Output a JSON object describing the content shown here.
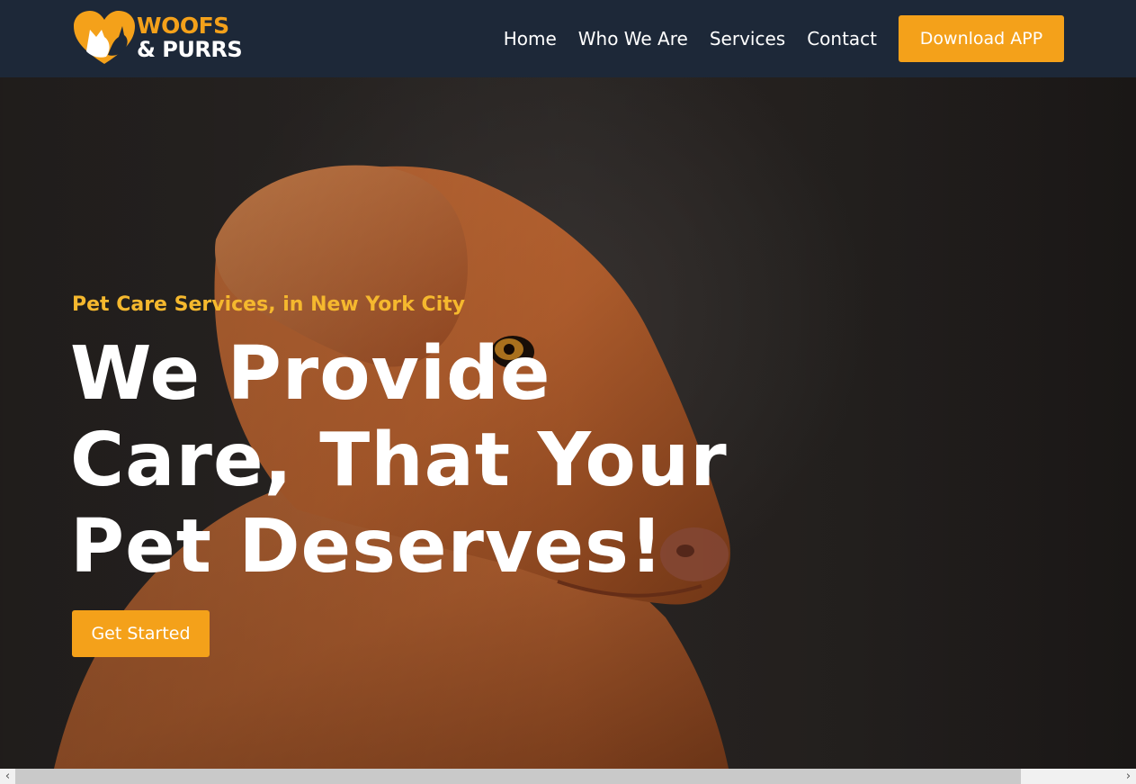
{
  "brand": {
    "line1": "WOOFS",
    "line2": "& PURRS",
    "logo_icon": "heart-dog-cat-icon",
    "primary_color": "#f4a11a",
    "nav_background": "#1d2838"
  },
  "nav": {
    "links": [
      {
        "label": "Home"
      },
      {
        "label": "Who We Are"
      },
      {
        "label": "Services"
      },
      {
        "label": "Contact"
      }
    ],
    "download_label": "Download APP"
  },
  "hero": {
    "tagline": "Pet Care Services, in New York City",
    "headline_lines": [
      "We Provide",
      "Care, That Your",
      "Pet Deserves!"
    ],
    "cta_label": "Get Started",
    "tagline_color": "#f5b82e"
  },
  "scrollbar": {
    "left_arrow": "‹",
    "right_arrow": "›"
  }
}
